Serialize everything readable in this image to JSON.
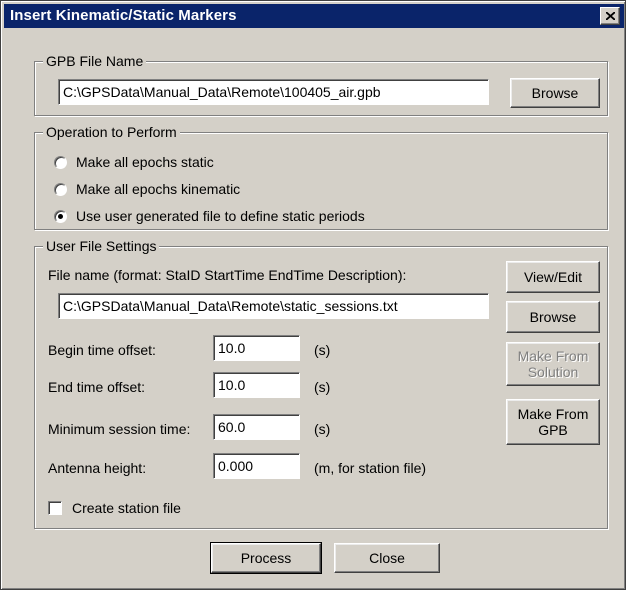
{
  "window": {
    "title": "Insert Kinematic/Static Markers",
    "close_glyph": "×"
  },
  "gpb_group": {
    "legend": "GPB File Name",
    "path_value": "C:\\GPSData\\Manual_Data\\Remote\\100405_air.gpb",
    "browse_label": "Browse"
  },
  "operation_group": {
    "legend": "Operation to Perform",
    "options": [
      {
        "label": "Make all epochs static",
        "checked": false
      },
      {
        "label": "Make all epochs kinematic",
        "checked": false
      },
      {
        "label": "Use user generated file to define static periods",
        "checked": true
      }
    ]
  },
  "user_file_group": {
    "legend": "User File Settings",
    "file_name_label": "File name (format: StaID StartTime EndTime Description):",
    "file_name_value": "C:\\GPSData\\Manual_Data\\Remote\\static_sessions.txt",
    "view_edit_label": "View/Edit",
    "browse_label": "Browse",
    "make_from_solution_line1": "Make From",
    "make_from_solution_line2": "Solution",
    "make_from_gpb_line1": "Make From",
    "make_from_gpb_line2": "GPB",
    "begin_offset_label": "Begin time offset:",
    "begin_offset_value": "10.0",
    "begin_offset_unit": "(s)",
    "end_offset_label": "End time offset:",
    "end_offset_value": "10.0",
    "end_offset_unit": "(s)",
    "min_session_label": "Minimum session time:",
    "min_session_value": "60.0",
    "min_session_unit": "(s)",
    "antenna_label": "Antenna height:",
    "antenna_value": "0.000",
    "antenna_unit": "(m, for station file)",
    "create_station_label": "Create station file",
    "create_station_checked": false
  },
  "footer": {
    "process_label": "Process",
    "close_label": "Close"
  },
  "colors": {
    "dialog_face": "#d4d0c8",
    "title_bar": "#0a246a",
    "title_text": "#ffffff",
    "disabled_text": "#808080"
  }
}
